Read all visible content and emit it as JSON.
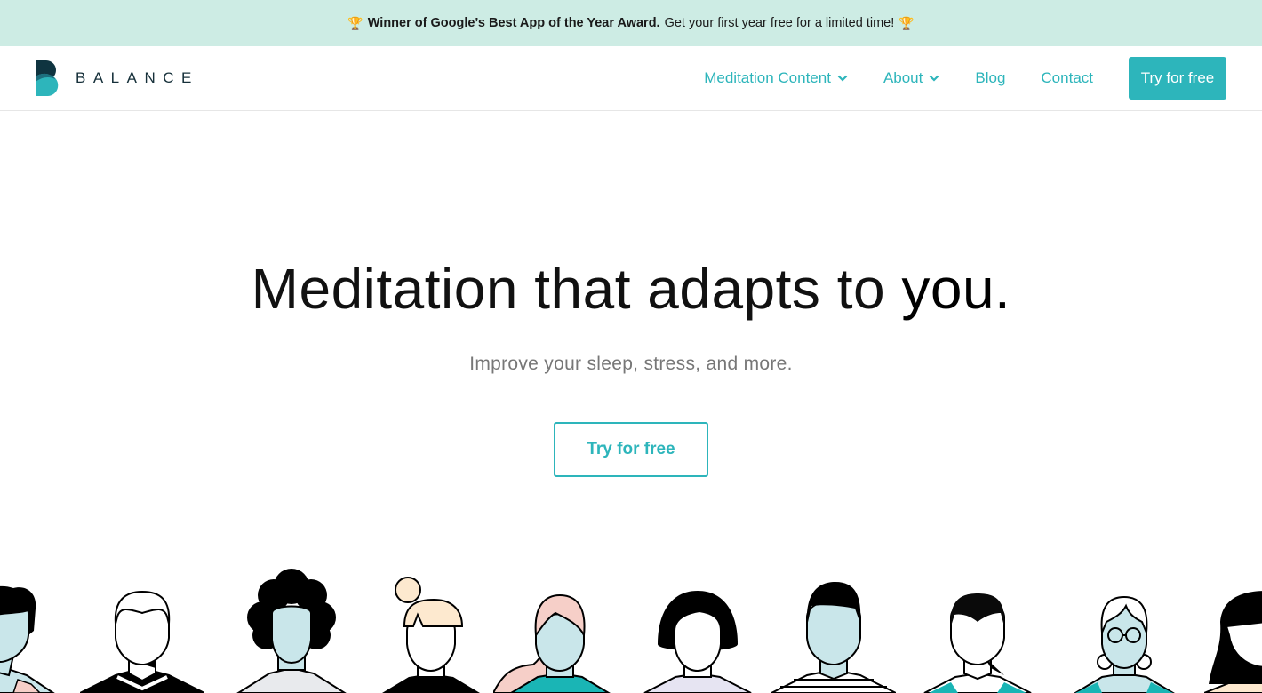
{
  "announcement": {
    "icon": "trophy-icon",
    "bold_text": "Winner of Google’s Best App of the Year Award.",
    "text": "Get your first year free for a limited time!"
  },
  "brand": {
    "name": "BALANCE",
    "colors": {
      "accent": "#2db5bb",
      "dark": "#0f3440",
      "banner_bg": "#cdece4"
    }
  },
  "nav": {
    "items": [
      {
        "label": "Meditation Content",
        "has_dropdown": true
      },
      {
        "label": "About",
        "has_dropdown": true
      },
      {
        "label": "Blog",
        "has_dropdown": false
      },
      {
        "label": "Contact",
        "has_dropdown": false
      }
    ],
    "cta_label": "Try for free"
  },
  "hero": {
    "title_main": "Meditation that adapts to ",
    "title_emphasis": "you.",
    "subtitle": "Improve your sleep, stress, and more.",
    "cta_label": "Try for free"
  },
  "illustration": {
    "description": "Row of diverse faceless people illustrations",
    "people_count": 11
  }
}
